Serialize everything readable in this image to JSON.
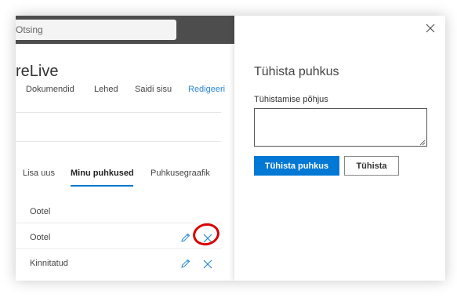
{
  "search": {
    "placeholder": "Otsing"
  },
  "site": {
    "title": "reLive"
  },
  "nav": {
    "items": [
      "Dokumendid",
      "Lehed",
      "Saidi sisu"
    ],
    "edit": "Redigeeri"
  },
  "tabs": [
    {
      "label": "Lisa uus",
      "active": false
    },
    {
      "label": "Minu puhkused",
      "active": true
    },
    {
      "label": "Puhkusegraafik",
      "active": false
    }
  ],
  "rows": [
    {
      "status": "Ootel",
      "actions": false
    },
    {
      "status": "Ootel",
      "actions": true,
      "highlighted": true
    },
    {
      "status": "Kinnitatud",
      "actions": true
    }
  ],
  "panel": {
    "title": "Tühista puhkus",
    "field_label": "Tühistamise põhjus",
    "field_value": "",
    "primary_label": "Tühista puhkus",
    "secondary_label": "Tühista",
    "close_icon": "close-icon"
  },
  "colors": {
    "accent": "#0078d4",
    "link": "#2b88d8",
    "topbar": "#4d4d4d",
    "highlight": "#d90000"
  }
}
